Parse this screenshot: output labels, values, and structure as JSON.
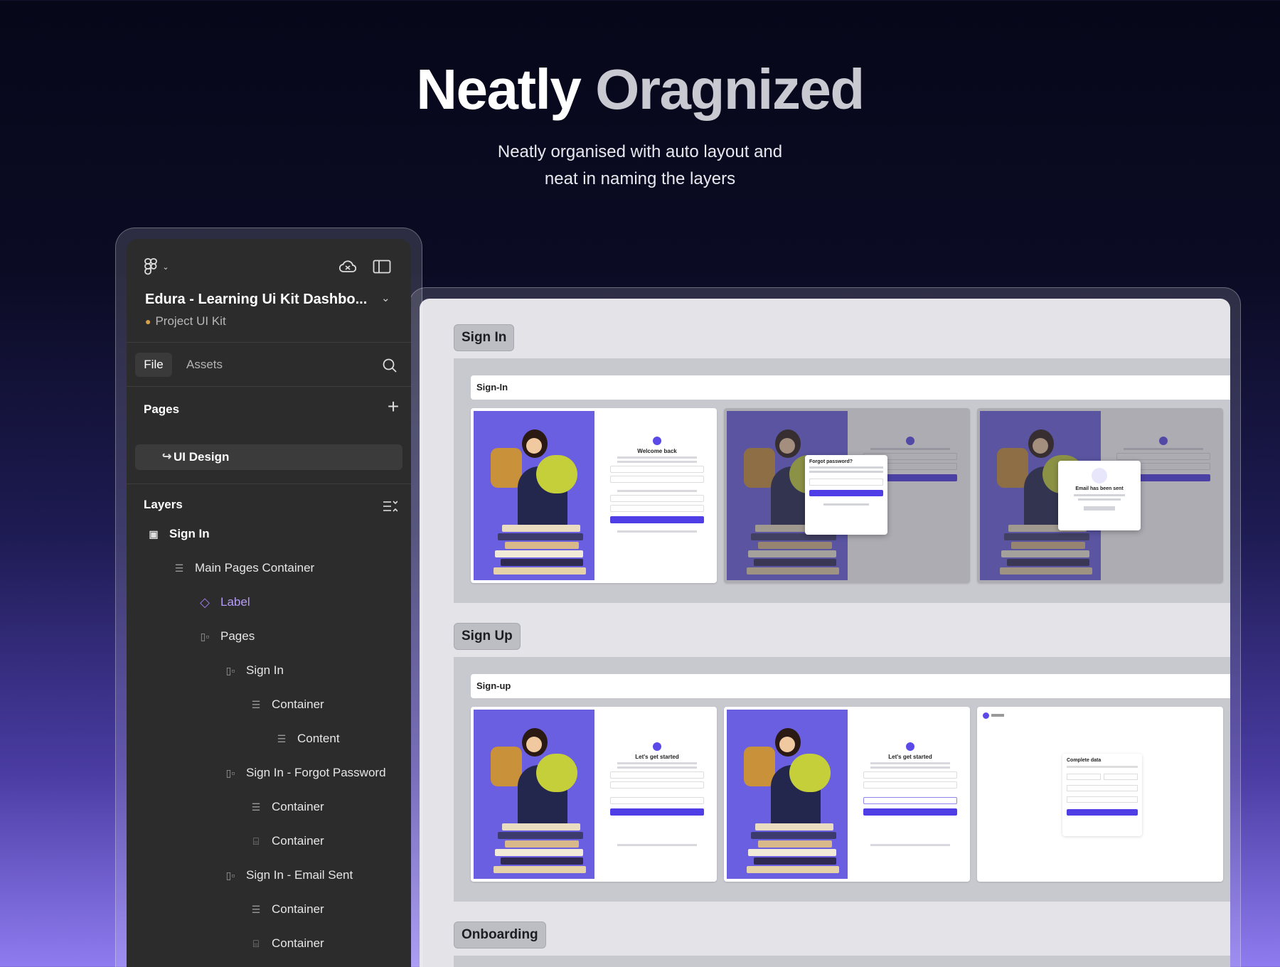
{
  "hero": {
    "title_part1": "Neatly",
    "title_part2": "Oragnized",
    "subtitle_line1": "Neatly organised with auto layout and",
    "subtitle_line2": "neat in naming the layers"
  },
  "panel": {
    "file_title": "Edura - Learning Ui Kit Dashbo...",
    "project": "Project UI Kit",
    "tabs": {
      "file": "File",
      "assets": "Assets"
    },
    "pages_heading": "Pages",
    "page_items": [
      {
        "label": "UI Design"
      }
    ],
    "layers_heading": "Layers",
    "layers": [
      {
        "label": "Sign In",
        "icon": "frame-icon"
      },
      {
        "label": "Main Pages Container",
        "icon": "auto-layout-vertical-icon"
      },
      {
        "label": "Label",
        "icon": "component-instance-icon"
      },
      {
        "label": "Pages",
        "icon": "auto-layout-horizontal-icon"
      },
      {
        "label": "Sign In",
        "icon": "auto-layout-horizontal-icon"
      },
      {
        "label": "Container",
        "icon": "auto-layout-vertical-icon"
      },
      {
        "label": "Content",
        "icon": "auto-layout-vertical-icon"
      },
      {
        "label": "Sign In - Forgot Password",
        "icon": "auto-layout-horizontal-icon"
      },
      {
        "label": "Container",
        "icon": "auto-layout-vertical-icon"
      },
      {
        "label": "Container",
        "icon": "frame-absolute-icon"
      },
      {
        "label": "Sign In - Email Sent",
        "icon": "auto-layout-horizontal-icon"
      },
      {
        "label": "Container",
        "icon": "auto-layout-vertical-icon"
      },
      {
        "label": "Container",
        "icon": "frame-absolute-icon"
      }
    ]
  },
  "canvas": {
    "sections": [
      {
        "label": "Sign In",
        "inner_label": "Sign-In",
        "screens": [
          {
            "title": "Welcome back"
          },
          {
            "title": "Forgot password?"
          },
          {
            "title": "Email has been sent"
          }
        ]
      },
      {
        "label": "Sign Up",
        "inner_label": "Sign-up",
        "screens": [
          {
            "title": "Let's get started"
          },
          {
            "title": "Let's get started"
          },
          {
            "title": "Complete data"
          }
        ]
      },
      {
        "label": "Onboarding"
      }
    ]
  },
  "colors": {
    "accent": "#5b4ae8",
    "panel_bg": "#2c2c2c",
    "selected_layer": "#b69cf6"
  }
}
